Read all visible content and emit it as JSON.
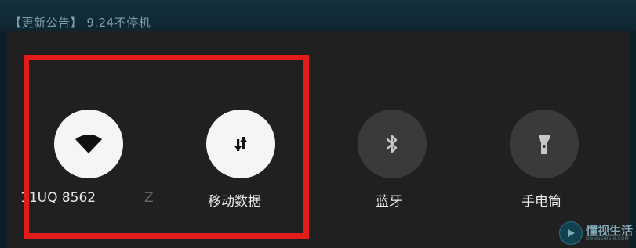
{
  "announcement": {
    "bracket_open": "【",
    "title": "更新公告",
    "bracket_close": "】",
    "text": "9.24不停机"
  },
  "quick_settings": {
    "tiles": [
      {
        "icon": "wifi-icon",
        "label": "11UQ 8562",
        "state": "on"
      },
      {
        "icon": "mobile-data-icon",
        "label": "移动数据",
        "state": "on"
      },
      {
        "icon": "bluetooth-icon",
        "label": "蓝牙",
        "state": "off"
      },
      {
        "icon": "flashlight-icon",
        "label": "手电筒",
        "state": "off"
      }
    ],
    "partial_label": "Z"
  },
  "annotation": {
    "color": "#e31b1b"
  },
  "watermark": {
    "text": "懂视生活",
    "sub": "DONGSHISHI.COM"
  },
  "colors": {
    "panel": "#202020",
    "tile_on": "#f5f5f5",
    "tile_off": "#3a3a3a",
    "background": "#0c1e27"
  }
}
